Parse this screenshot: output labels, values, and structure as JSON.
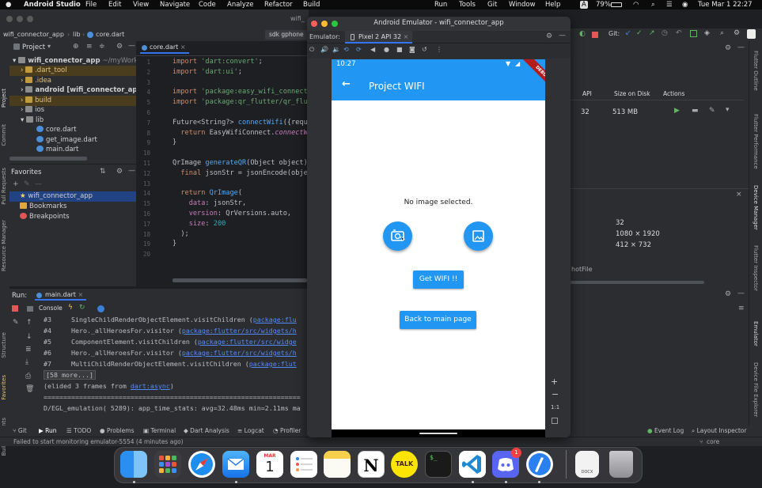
{
  "menubar": {
    "app_name": "Android Studio",
    "items": [
      "File",
      "Edit",
      "View",
      "Navigate",
      "Code",
      "Analyze",
      "Refactor",
      "Build",
      "Run",
      "Tools",
      "Git",
      "Window",
      "Help"
    ],
    "battery": "79%",
    "clock": "Tue Mar 1  22:27"
  },
  "ide": {
    "window_title_fragment": "wifi_",
    "breadcrumb": [
      "wifi_connector_app",
      "lib",
      "core.dart"
    ],
    "editor_tab_right": "sdk gphone",
    "project_dropdown": "Project",
    "editor_tab": "core.dart",
    "tree": [
      {
        "label": "wifi_connector_app",
        "suffix": "~/myWork"
      },
      {
        "label": ".dart_tool"
      },
      {
        "label": ".idea"
      },
      {
        "label": "android",
        "suffix": "[wifi_connector_app]"
      },
      {
        "label": "build"
      },
      {
        "label": "ios"
      },
      {
        "label": "lib"
      },
      {
        "label": "core.dart"
      },
      {
        "label": "get_image.dart"
      },
      {
        "label": "main.dart"
      }
    ],
    "favorites_title": "Favorites",
    "favorites": [
      "wifi_connector_app",
      "Bookmarks",
      "Breakpoints"
    ],
    "line_numbers": [
      "1",
      "2",
      "3",
      "4",
      "5",
      "6",
      "7",
      "8",
      "9",
      "10",
      "11",
      "12",
      "13",
      "14",
      "15",
      "16",
      "17",
      "18",
      "19",
      "20"
    ],
    "left_strip_labels": [
      "Project",
      "Commit",
      "Pull Requests",
      "Resource Manager",
      "Structure",
      "Favorites",
      "Build Variants"
    ],
    "right_strip_labels": [
      "Flutter Outline",
      "Flutter Performance",
      "Device Manager",
      "Flutter Inspector",
      "Emulator",
      "Device File Explorer"
    ],
    "device_manager": {
      "columns": [
        "API",
        "Size on Disk",
        "Actions"
      ],
      "row": {
        "api": "32",
        "size": "513 MB"
      },
      "details": [
        "32",
        "1080 × 1920",
        "412 × 732"
      ],
      "snapshot_label": "hotFile"
    }
  },
  "code_lines": [
    "import 'dart:convert';",
    "import 'dart:ui';",
    "",
    "import 'package:easy_wifi_connect",
    "import 'package:qr_flutter/qr_flu",
    "",
    "Future<String?> connectWifi({requ",
    "  return EasyWifiConnect.connectW",
    "}",
    "",
    "QrImage generateQR(Object object)",
    "  final jsonStr = jsonEncode(obje",
    "",
    "  return QrImage(",
    "    data: jsonStr,",
    "    version: QrVersions.auto,",
    "    size: 200",
    "  );",
    "}",
    ""
  ],
  "run_panel": {
    "label": "Run:",
    "tab": "main.dart",
    "console_tab": "Console",
    "lines": [
      "#3     SingleChildRenderObjectElement.visitChildren (package:flu",
      "#4     Hero._allHeroesFor.visitor (package:flutter/src/widgets/h",
      "#5     ComponentElement.visitChildren (package:flutter/src/widge",
      "#6     Hero._allHeroesFor.visitor (package:flutter/src/widgets/h",
      "#7     MultiChildRenderObjectElement.visitChildren (package:flut",
      "[58 more...]",
      "(elided 3 frames from dart:async)",
      "=================================================================",
      "D/EGL_emulation( 5289): app_time_stats: avg=32.48ms min=2.11ms ma"
    ]
  },
  "bottom_tabs": [
    "Git",
    "Run",
    "TODO",
    "Problems",
    "Terminal",
    "Dart Analysis",
    "Logcat",
    "Profiler"
  ],
  "bottom_tabs_right": [
    "Event Log",
    "Layout Inspector"
  ],
  "status": {
    "message": "Failed to start monitoring emulator-5554 (4 minutes ago)",
    "right": "core"
  },
  "emulator": {
    "window_title": "Android Emulator - wifi_connector_app",
    "tool_label": "Emulator:",
    "device_tab": "Pixel 2 API 32",
    "zoom_ratio": "1:1",
    "phone": {
      "time": "10:27",
      "debug_banner": "DEBUG",
      "appbar_title": "Project WIFI",
      "no_image_text": "No image selected.",
      "get_wifi_button": "Get WIFI !!",
      "back_button": "Back to main page"
    }
  },
  "dock": {
    "items": [
      "Finder",
      "Launchpad",
      "Safari",
      "Mail",
      "Calendar",
      "Reminders",
      "Notes",
      "Notion",
      "KakaoTalk",
      "Terminal",
      "Visual Studio Code",
      "Discord",
      "Xcode",
      "Document",
      "Trash"
    ],
    "calendar_month": "MAR",
    "calendar_day": "1",
    "notif_badge": "1",
    "talk_label": "TALK",
    "doc_label": "DOCX"
  },
  "colors": {
    "flutter_blue": "#2196f3",
    "ide_bg": "#1e1f22",
    "panel_bg": "#2b2d30",
    "selection": "#214283"
  }
}
